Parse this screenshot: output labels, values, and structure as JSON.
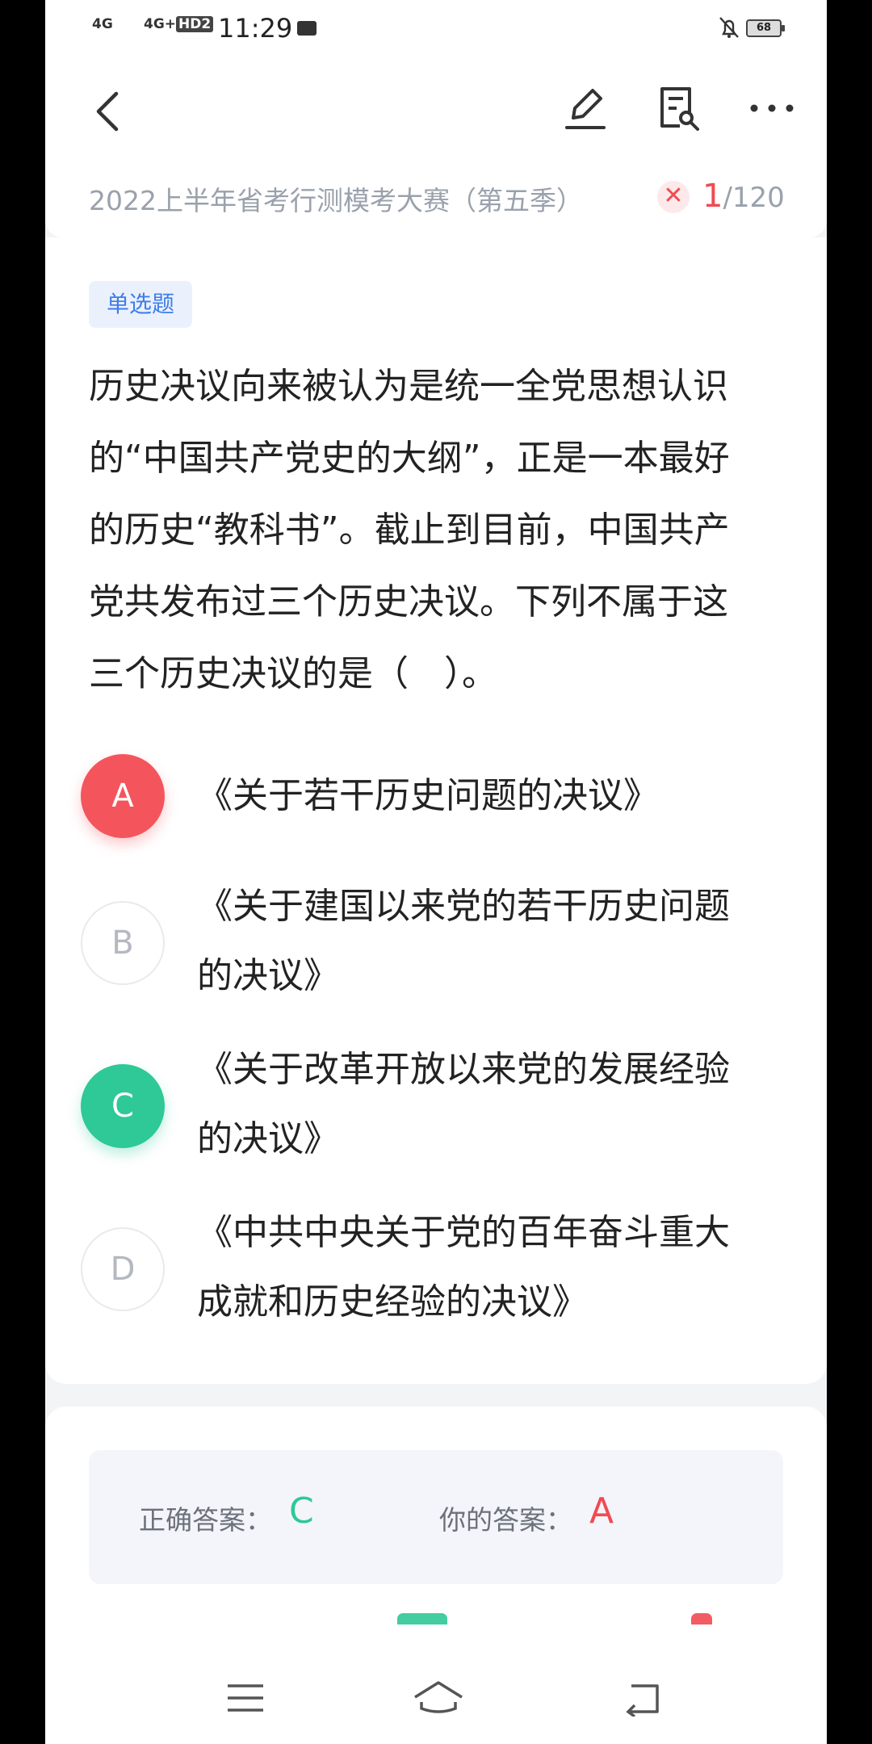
{
  "status_bar": {
    "signal1": "4G",
    "signal2": "4G+",
    "hd": "HD2",
    "time": "11:29",
    "battery": "68"
  },
  "header": {
    "exam_title": "2022上半年省考行测模考大赛（第五季）",
    "progress_current": "1",
    "progress_total": "/120",
    "wrong_mark": "✕"
  },
  "question": {
    "type_tag": "单选题",
    "lines": [
      "历史决议向来被认为是统一全党思想认识",
      "的“中国共产党史的大纲”，正是一本最好",
      "的历史“教科书”。截止到目前，中国共产",
      "党共发布过三个历史决议。下列不属于这",
      "三个历史决议的是（　）。"
    ],
    "options": [
      {
        "letter": "A",
        "state": "wrong",
        "lines": [
          "《关于若干历史问题的决议》"
        ]
      },
      {
        "letter": "B",
        "state": "plain",
        "lines": [
          "《关于建国以来党的若干历史问题",
          "的决议》"
        ]
      },
      {
        "letter": "C",
        "state": "right",
        "lines": [
          "《关于改革开放以来党的发展经验",
          "的决议》"
        ]
      },
      {
        "letter": "D",
        "state": "plain",
        "lines": [
          "《中共中央关于党的百年奋斗重大",
          "成就和历史经验的决议》"
        ]
      }
    ]
  },
  "answer": {
    "correct_label": "正确答案：",
    "correct_value": "C",
    "yours_label": "你的答案：",
    "yours_value": "A"
  },
  "colors": {
    "wrong": "#f04b52",
    "right": "#2fc897",
    "tag_blue": "#3f7de8"
  },
  "icons": [
    "back-icon",
    "edit-icon",
    "answer-sheet-icon",
    "more-icon",
    "menu-icon",
    "home-icon",
    "back-nav-icon"
  ]
}
